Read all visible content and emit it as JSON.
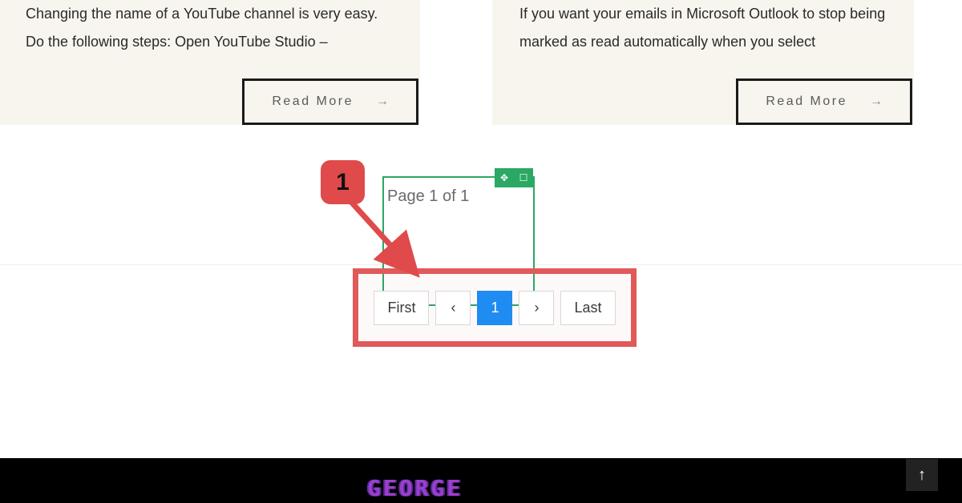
{
  "cards": [
    {
      "excerpt": "Changing the name of a YouTube channel is very easy. Do the following steps: Open YouTube Studio –",
      "readMore": "Read More"
    },
    {
      "excerpt": "If you want your emails in Microsoft Outlook to stop being marked as read automatically when you select",
      "readMore": "Read More"
    }
  ],
  "annotation": {
    "badge": "1"
  },
  "editorPanel": {
    "pageLabel": "Page 1 of 1"
  },
  "pagination": {
    "first": "First",
    "prevGlyph": "‹",
    "current": "1",
    "nextGlyph": "›",
    "last": "Last"
  },
  "footer": {
    "brand": "GEORGE"
  },
  "icons": {
    "arrowRight": "→",
    "arrowUp": "↑",
    "move": "✥",
    "square": "☐"
  }
}
